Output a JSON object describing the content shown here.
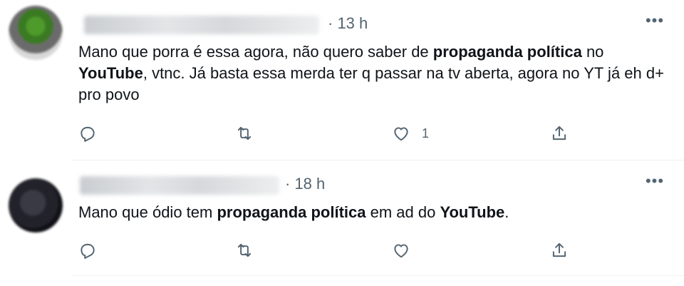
{
  "tweets": [
    {
      "time": "· 13 h",
      "more": "•••",
      "text_parts": [
        {
          "t": "Mano que porra é essa agora, não quero saber de ",
          "b": false
        },
        {
          "t": "propaganda política",
          "b": true
        },
        {
          "t": " no ",
          "b": false
        },
        {
          "t": "YouTube",
          "b": true
        },
        {
          "t": ", vtnc. Já basta essa merda ter q passar na tv aberta, agora no YT já eh d+ pro povo",
          "b": false
        }
      ],
      "actions": {
        "reply_icon": "reply-icon",
        "retweet_icon": "retweet-icon",
        "like_icon": "heart-icon",
        "like_count": "1",
        "share_icon": "share-icon"
      }
    },
    {
      "time": "· 18 h",
      "more": "•••",
      "text_parts": [
        {
          "t": "Mano que ódio tem ",
          "b": false
        },
        {
          "t": "propaganda política",
          "b": true
        },
        {
          "t": " em ad do ",
          "b": false
        },
        {
          "t": "YouTube",
          "b": true
        },
        {
          "t": ".",
          "b": false
        }
      ],
      "actions": {
        "reply_icon": "reply-icon",
        "retweet_icon": "retweet-icon",
        "like_icon": "heart-icon",
        "like_count": "",
        "share_icon": "share-icon"
      }
    }
  ],
  "colors": {
    "text": "#0f1419",
    "secondary": "#536471",
    "divider": "#eff3f4"
  }
}
